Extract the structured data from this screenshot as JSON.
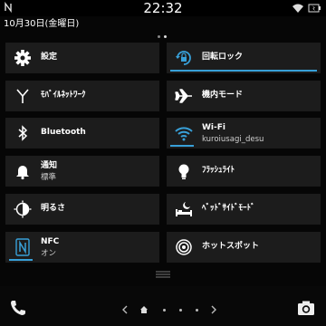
{
  "status_bar": {
    "time": "22:32",
    "nfc_icon": "nfc-n-icon",
    "wifi_icon": "wifi-icon",
    "battery_icon": "battery-icon"
  },
  "date": "10月30日(金曜日)",
  "tiles": {
    "settings": {
      "label": "設定",
      "icon": "gear-icon"
    },
    "rotation": {
      "label": "回転ロック",
      "icon": "rotation-lock-icon",
      "active": true
    },
    "mobile": {
      "label": "ﾓﾊﾞｲﾙﾈｯﾄﾜｰｸ",
      "icon": "antenna-icon"
    },
    "airplane": {
      "label": "機内モード",
      "icon": "airplane-icon"
    },
    "bluetooth": {
      "label": "Bluetooth",
      "icon": "bluetooth-icon"
    },
    "wifi": {
      "label": "Wi-Fi",
      "sub": "kuroiusagi_desu",
      "icon": "wifi-icon",
      "active": true
    },
    "notify": {
      "label": "通知",
      "sub": "標準",
      "icon": "bell-icon"
    },
    "flashlight": {
      "label": "ﾌﾗｯｼｭﾗｲﾄ",
      "icon": "lightbulb-icon"
    },
    "brightness": {
      "label": "明るさ",
      "icon": "brightness-icon"
    },
    "bedside": {
      "label": "ﾍﾞｯﾄﾞｻｲﾄﾞﾓｰﾄﾞ",
      "icon": "bedside-moon-icon"
    },
    "nfc": {
      "label": "NFC",
      "sub": "オン",
      "icon": "nfc-icon",
      "active": true
    },
    "hotspot": {
      "label": "ホットスポット",
      "icon": "hotspot-icon"
    }
  },
  "accent_color": "#38a0d8",
  "bottom_bar": {
    "phone_icon": "phone-icon",
    "camera_icon": "camera-icon",
    "home_icon": "home-icon"
  }
}
